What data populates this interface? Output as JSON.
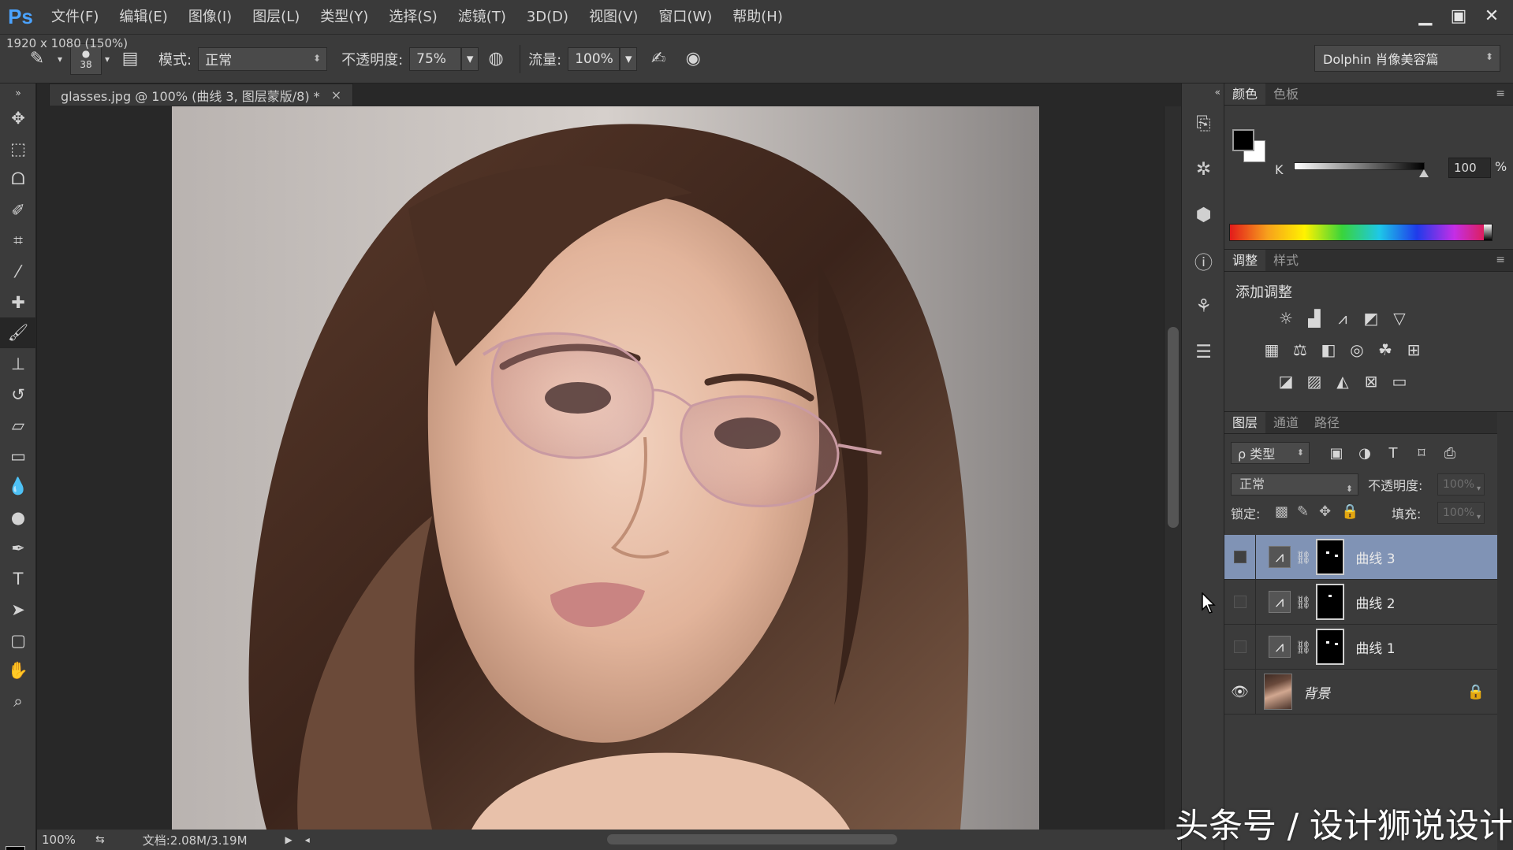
{
  "app": {
    "logo": "Ps",
    "size_hint": "1920 x 1080 (150%)"
  },
  "menu": [
    "文件(F)",
    "编辑(E)",
    "图像(I)",
    "图层(L)",
    "类型(Y)",
    "选择(S)",
    "滤镜(T)",
    "3D(D)",
    "视图(V)",
    "窗口(W)",
    "帮助(H)"
  ],
  "options": {
    "brush_size": "38",
    "mode_label": "模式:",
    "mode_value": "正常",
    "opacity_label": "不透明度:",
    "opacity_value": "75%",
    "flow_label": "流量:",
    "flow_value": "100%",
    "preset": "Dolphin 肖像美容篇"
  },
  "document": {
    "tab_title": "glasses.jpg @ 100% (曲线 3, 图层蒙版/8) *",
    "close": "×",
    "zoom": "100%",
    "doc_info": "文档:2.08M/3.19M"
  },
  "color_panel": {
    "tabs": [
      "颜色",
      "色板"
    ],
    "k_label": "K",
    "k_value": "100",
    "pct": "%"
  },
  "adjustments_panel": {
    "tabs": [
      "调整",
      "样式"
    ],
    "title": "添加调整"
  },
  "layers_panel": {
    "tabs": [
      "图层",
      "通道",
      "路径"
    ],
    "kind_filter": "ρ 类型",
    "blend_mode": "正常",
    "opacity_label": "不透明度:",
    "opacity_value": "100%",
    "lock_label": "锁定:",
    "fill_label": "填充:",
    "fill_value": "100%",
    "layers": [
      {
        "name": "曲线 3",
        "selected": true
      },
      {
        "name": "曲线 2",
        "selected": false
      },
      {
        "name": "曲线 1",
        "selected": false
      },
      {
        "name": "背景",
        "selected": false
      }
    ]
  },
  "watermark": "头条号 / 设计狮说设计",
  "icons": {
    "close": "close-icon",
    "eye": "eye-icon",
    "lock": "lock-icon",
    "chain": "link-icon"
  }
}
